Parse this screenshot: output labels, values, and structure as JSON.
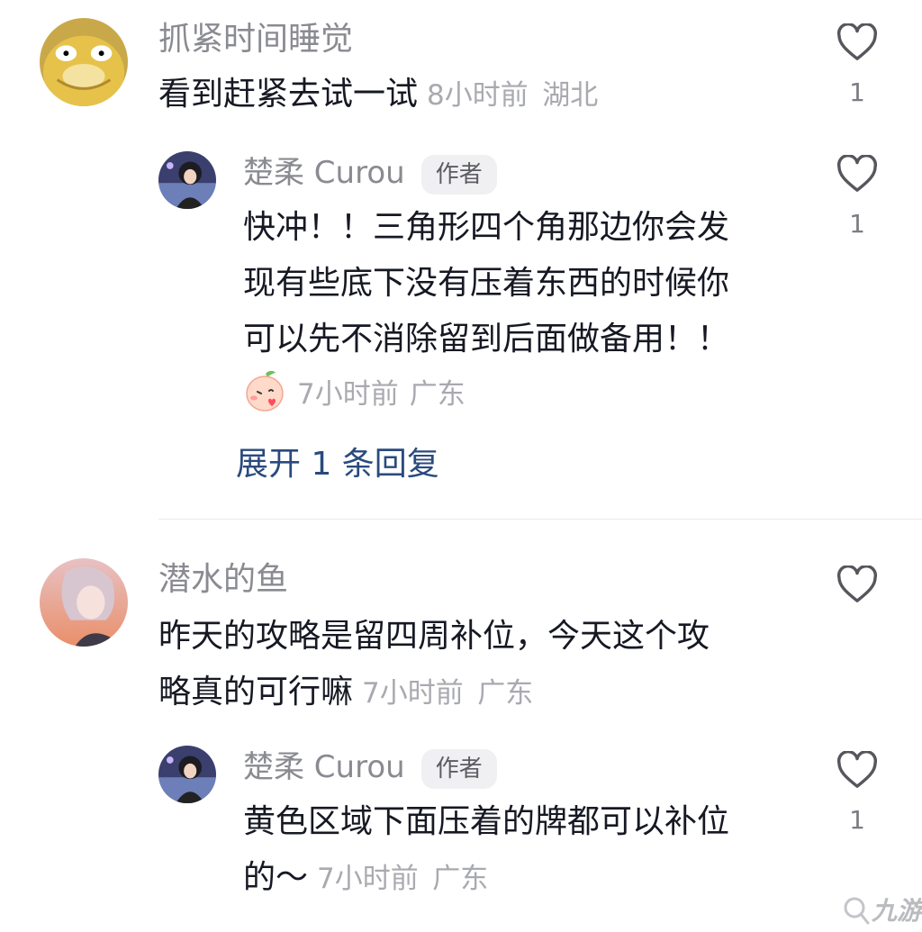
{
  "comments": [
    {
      "username": "抓紧时间睡觉",
      "text": "看到赶紧去试一试",
      "time": "8小时前",
      "location": "湖北",
      "likes": "1",
      "avatar_icon": "yellow-duck-avatar",
      "reply": {
        "username": "楚柔 Curou",
        "badge": "作者",
        "lines": [
          "快冲！！三角形四个角那边你会发",
          "现有些底下没有压着东西的时候你",
          "可以先不消除留到后面做备用！！"
        ],
        "time": "7小时前",
        "location": "广东",
        "likes": "1",
        "emoji_icon": "peach-kiss-emoji"
      },
      "expand_label": "展开 1 条回复"
    },
    {
      "username": "潜水的鱼",
      "lines": [
        "昨天的攻略是留四周补位，今天这个攻",
        "略真的可行嘛"
      ],
      "time": "7小时前",
      "location": "广东",
      "likes": "",
      "avatar_icon": "anime-boy-avatar",
      "reply": {
        "username": "楚柔 Curou",
        "badge": "作者",
        "lines": [
          "黄色区域下面压着的牌都可以补位",
          "的～"
        ],
        "time": "7小时前",
        "location": "广东",
        "likes": "1"
      }
    }
  ],
  "watermark": "九游",
  "colors": {
    "link": "#2a4a7e",
    "meta": "#a9aab0",
    "username": "#8a8b91"
  }
}
